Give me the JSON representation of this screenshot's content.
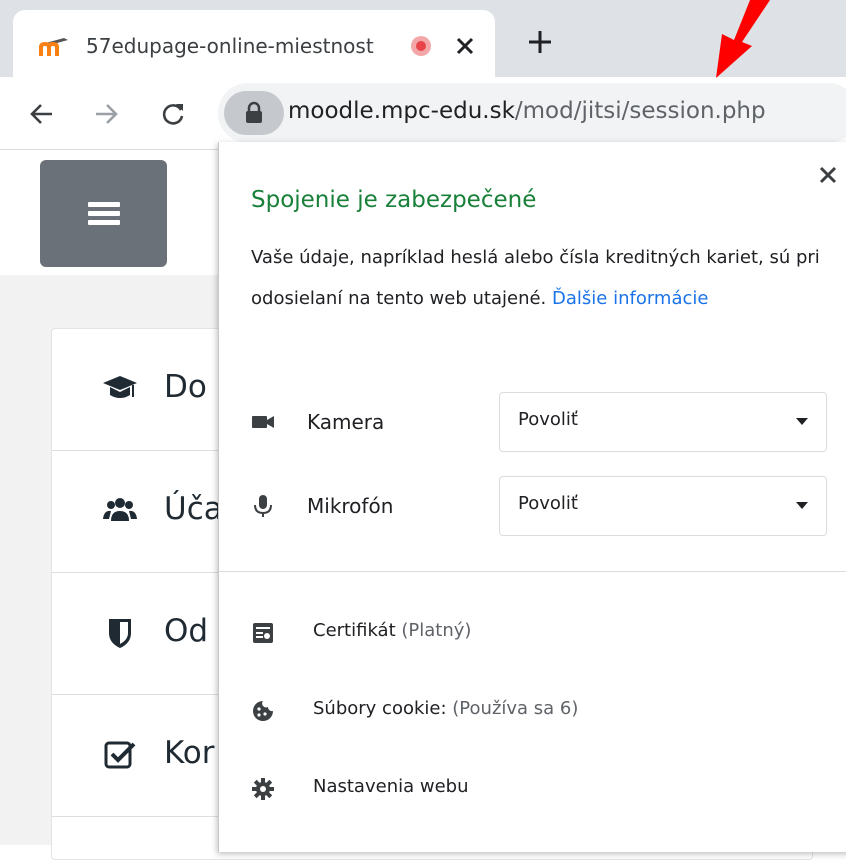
{
  "browser": {
    "tab": {
      "title": "57edupage-online-miestnost",
      "favicon": "moodle-favicon",
      "recording_indicator": "recording-dot-icon"
    },
    "url": {
      "host": "moodle.mpc-edu.sk",
      "path": "/mod/jitsi/session.php"
    }
  },
  "page": {
    "nav_items": [
      {
        "icon": "graduation-cap-icon",
        "label": "Do"
      },
      {
        "icon": "users-icon",
        "label": "Úča"
      },
      {
        "icon": "shield-icon",
        "label": "Od"
      },
      {
        "icon": "checkbox-icon",
        "label": "Kor"
      }
    ]
  },
  "popup": {
    "title": "Spojenie je zabezpečené",
    "description": "Vaše údaje, napríklad heslá alebo čísla kreditných kariet, sú pri odosielaní na tento web utajené.",
    "learn_more": "Ďalšie informácie",
    "permissions": [
      {
        "label": "Kamera",
        "value": "Povoliť",
        "icon": "camera-icon"
      },
      {
        "label": "Mikrofón",
        "value": "Povoliť",
        "icon": "microphone-icon"
      }
    ],
    "certificate": {
      "label": "Certifikát",
      "status": "(Platný)"
    },
    "cookies": {
      "label": "Súbory cookie:",
      "status": "(Používa sa 6)"
    },
    "site_settings": "Nastavenia webu"
  },
  "colors": {
    "secure_green": "#188038",
    "link_blue": "#1a73e8",
    "annotation_red": "#ff0000"
  }
}
